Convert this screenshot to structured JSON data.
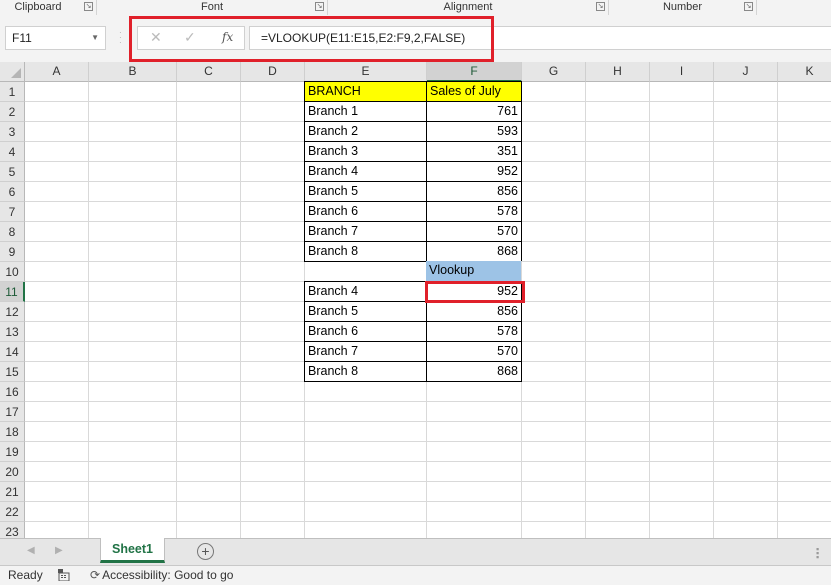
{
  "ribbon_groups": [
    {
      "label": "Clipboard"
    },
    {
      "label": "Font"
    },
    {
      "label": "Alignment"
    },
    {
      "label": "Number"
    }
  ],
  "formula_bar": {
    "name_box": "F11",
    "cancel_icon": "✕",
    "enter_icon": "✓",
    "fx_label": "fx",
    "formula": "=VLOOKUP(E11:E15,E2:F9,2,FALSE)"
  },
  "columns": [
    "A",
    "B",
    "C",
    "D",
    "E",
    "F",
    "G",
    "H",
    "I",
    "J",
    "K"
  ],
  "selected_column": "F",
  "rows": [
    "1",
    "2",
    "3",
    "4",
    "5",
    "6",
    "7",
    "8",
    "9",
    "10",
    "11",
    "12",
    "13",
    "14",
    "15",
    "16",
    "17",
    "18",
    "19",
    "20",
    "21",
    "22",
    "23"
  ],
  "selected_row": "11",
  "table": {
    "header": {
      "branch": "BRANCH",
      "sales": "Sales of July"
    },
    "rows": [
      {
        "branch": "Branch 1",
        "sales": "761"
      },
      {
        "branch": "Branch 2",
        "sales": "593"
      },
      {
        "branch": "Branch 3",
        "sales": "351"
      },
      {
        "branch": "Branch 4",
        "sales": "952"
      },
      {
        "branch": "Branch 5",
        "sales": "856"
      },
      {
        "branch": "Branch 6",
        "sales": "578"
      },
      {
        "branch": "Branch 7",
        "sales": "570"
      },
      {
        "branch": "Branch 8",
        "sales": "868"
      }
    ]
  },
  "lookup": {
    "header": "Vlookup",
    "rows": [
      {
        "branch": "Branch 4",
        "value": "952"
      },
      {
        "branch": "Branch 5",
        "value": "856"
      },
      {
        "branch": "Branch 6",
        "value": "578"
      },
      {
        "branch": "Branch 7",
        "value": "570"
      },
      {
        "branch": "Branch 8",
        "value": "868"
      }
    ]
  },
  "colors": {
    "header_fill": "#ffff00",
    "vlookup_fill": "#9dc3e6",
    "highlight": "#e0202a",
    "accent": "#217346"
  },
  "sheet_tabs": [
    {
      "label": "Sheet1",
      "active": true
    }
  ],
  "add_sheet_icon": "+",
  "status": {
    "ready": "Ready",
    "accessibility": "Accessibility: Good to go"
  }
}
